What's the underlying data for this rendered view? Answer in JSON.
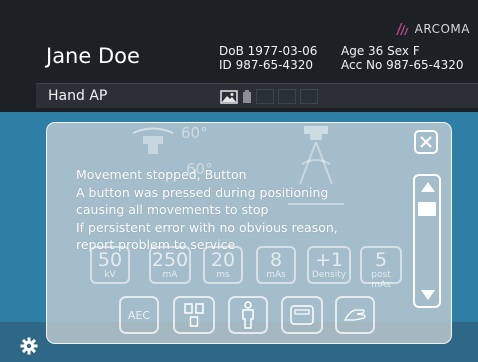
{
  "brand": {
    "name": "ARCOMA",
    "logo_icon": "arcoma-logo-icon"
  },
  "patient": {
    "name": "Jane Doe",
    "dob": "DoB 1977-03-06",
    "id": "ID 987-65-4320",
    "age_sex": "Age 36  Sex F",
    "acc_no": "Acc No 987-65-4320"
  },
  "exam": {
    "title": "Hand AP",
    "icons": [
      "image-icon",
      "detector-icon"
    ]
  },
  "background": {
    "angles": [
      "60°",
      "60°"
    ],
    "exposure": [
      {
        "value": "50",
        "unit": "kV"
      },
      {
        "value": "250",
        "unit": "mA"
      },
      {
        "value": "20",
        "unit": "ms"
      },
      {
        "value": "8",
        "unit": "mAs"
      },
      {
        "value": "+1",
        "unit": "Density"
      },
      {
        "value": "5",
        "unit": "post mAs"
      }
    ],
    "bottom_buttons": [
      "AEC",
      "field-select-icon",
      "patient-icon",
      "detector-select-icon",
      "hand-icon"
    ]
  },
  "dialog": {
    "lines": [
      "Movement stopped, Button",
      "A button was pressed during positioning",
      "causing all movements to stop",
      "If persistent error with no obvious reason,",
      "report problem to service"
    ],
    "close_icon": "close-icon",
    "scroll_up_icon": "arrow-up-icon",
    "scroll_down_icon": "arrow-down-icon"
  },
  "footer": {
    "settings_icon": "gear-icon"
  },
  "colors": {
    "topbar": "#1d2126",
    "screen": "#2e7fa6",
    "dialog": "#d2d6d8"
  }
}
